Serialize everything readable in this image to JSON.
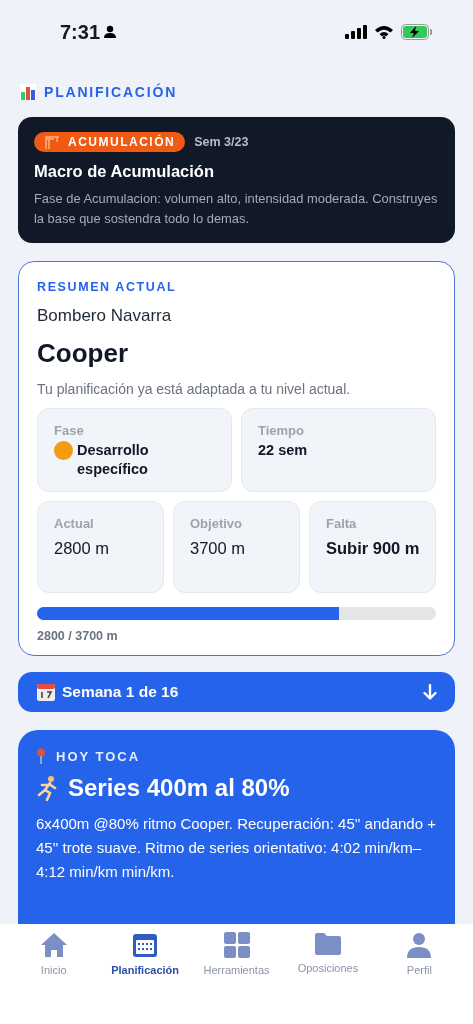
{
  "status_bar": {
    "time": "7:31"
  },
  "section_title": "PLANIFICACIÓN",
  "macro_card": {
    "badge": "ACUMULACIÓN",
    "week": "Sem 3/23",
    "title": "Macro de Acumulación",
    "description": "Fase de Acumulacion: volumen alto, intensidad moderada. Construyes la base que sostendra todo lo demas."
  },
  "summary": {
    "eyebrow": "RESUMEN ACTUAL",
    "subtitle": "Bombero Navarra",
    "title": "Cooper",
    "note": "Tu planificación ya está adaptada a tu nivel actual.",
    "top_stats": [
      {
        "label": "Fase",
        "value": "Desarrollo específico",
        "color": "#f39c12"
      },
      {
        "label": "Tiempo",
        "value": "22 sem"
      }
    ],
    "bottom_stats": [
      {
        "label": "Actual",
        "value": "2800 m",
        "bold": false
      },
      {
        "label": "Objetivo",
        "value": "3700 m",
        "bold": false
      },
      {
        "label": "Falta",
        "value": "Subir 900 m",
        "bold": true
      }
    ],
    "progress": {
      "level": 0.757,
      "reading": "2800 / 3700 m"
    }
  },
  "week_selector": {
    "label": "Semana 1 de 16",
    "expanded": false
  },
  "today_card": {
    "eyebrow": "HOY TOCA",
    "title": "Series 400m al 80%",
    "description": "6x400m @80% ritmo Cooper. Recuperación: 45'' andando + 45'' trote suave. Ritmo de series orientativo: 4:02 min/km–4:12 min/km min/km."
  },
  "tab_bar": [
    {
      "label": "Inicio",
      "kind": "home",
      "selected": false
    },
    {
      "label": "Planificación",
      "kind": "calendar",
      "selected": true
    },
    {
      "label": "Herramientas",
      "kind": "grid",
      "selected": false
    },
    {
      "label": "Oposiciones",
      "kind": "folder",
      "selected": false
    },
    {
      "label": "Perfil",
      "kind": "person",
      "selected": false
    }
  ]
}
